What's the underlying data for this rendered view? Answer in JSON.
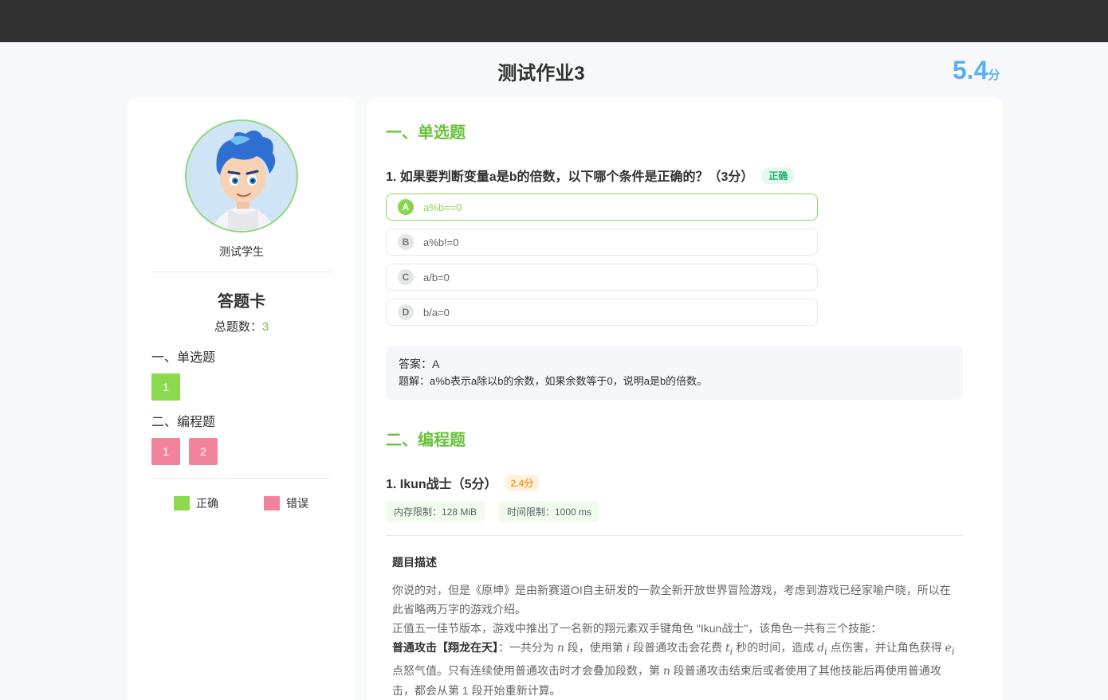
{
  "header": {
    "title": "测试作业3",
    "score": "5.4",
    "score_unit": "分"
  },
  "sidebar": {
    "student_name": "测试学生",
    "card_title": "答题卡",
    "total_label": "总题数：",
    "total_count": "3",
    "sections": [
      {
        "label": "一、单选题",
        "items": [
          {
            "num": "1",
            "status": "correct"
          }
        ]
      },
      {
        "label": "二、编程题",
        "items": [
          {
            "num": "1",
            "status": "wrong"
          },
          {
            "num": "2",
            "status": "wrong"
          }
        ]
      }
    ],
    "legend": {
      "correct": "正确",
      "wrong": "错误"
    }
  },
  "main": {
    "section1_title": "一、单选题",
    "q1": {
      "text": "1. 如果要判断变量a是b的倍数，以下哪个条件是正确的？（3分）",
      "status_tag": "正确",
      "options": [
        {
          "letter": "A",
          "text": "a%b==0"
        },
        {
          "letter": "B",
          "text": "a%b!=0"
        },
        {
          "letter": "C",
          "text": "a/b=0"
        },
        {
          "letter": "D",
          "text": "b/a=0"
        }
      ],
      "selected": "A",
      "answer": "答案：A",
      "explanation": "题解：a%b表示a除以b的余数，如果余数等于0，说明a是b的倍数。"
    },
    "section2_title": "二、编程题",
    "p1": {
      "title": "1. Ikun战士（5分）",
      "score_tag": "2.4分",
      "memory_limit": "内存限制：128 MiB",
      "time_limit": "时间限制：1000 ms",
      "desc_title": "题目描述",
      "para1": "你说的对，但是《原坤》是由新赛道OI自主研发的一款全新开放世界冒险游戏，考虑到游戏已经家喻户晓，所以在此省略两万字的游戏介绍。",
      "para2": "正值五一佳节版本，游戏中推出了一名新的翔元素双手键角色 \"Ikun战士\"，该角色一共有三个技能：",
      "para3_bold": "普通攻击【翔龙在天】",
      "para3_a": "：一共分为 ",
      "var_n": "n",
      "para3_b": " 段，使用第 ",
      "var_i": "i",
      "para3_c": " 段普通攻击会花费 ",
      "var_ti": "t",
      "para3_d": " 秒的时间，造成 ",
      "var_di": "d",
      "para3_e": " 点伤害，并让角色获得 ",
      "var_ei": "e",
      "para3_f": " 点怒气值。只有连续使用普通攻击时才会叠加段数，第 ",
      "para3_g": " 段普通攻击结束后或者使用了其他技能后再使用普通攻击，都会从第 1 段开始重新计算。",
      "sub_i": "i"
    }
  },
  "colors": {
    "accent_green": "#67c23a",
    "correct": "#8ad94e",
    "wrong": "#f3839a",
    "score_blue": "#5ab0f0"
  }
}
